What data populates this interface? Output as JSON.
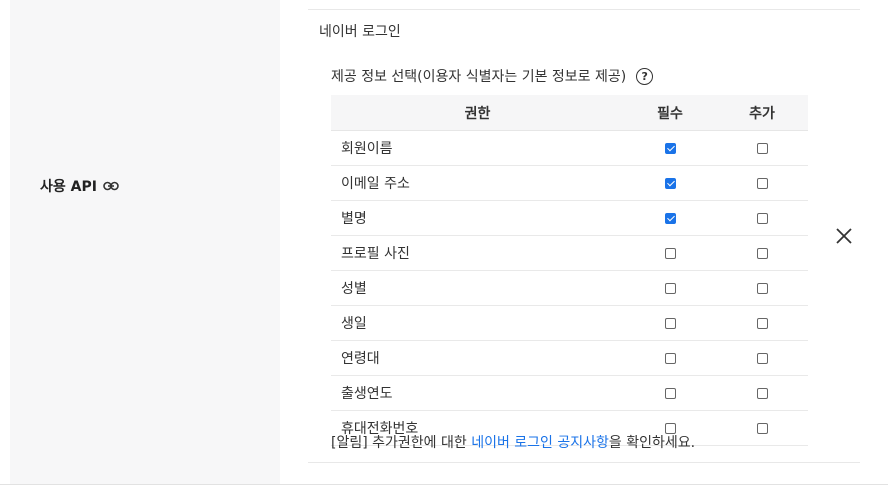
{
  "row_label": "사용 API",
  "service_title": "네이버 로그인",
  "info_text": "제공 정보 선택(이용자 식별자는 기본 정보로 제공)",
  "help_icon_char": "?",
  "table": {
    "headers": {
      "name": "권한",
      "required": "필수",
      "additional": "추가"
    },
    "rows": [
      {
        "name": "회원이름",
        "required": true,
        "additional": false
      },
      {
        "name": "이메일 주소",
        "required": true,
        "additional": false
      },
      {
        "name": "별명",
        "required": true,
        "additional": false
      },
      {
        "name": "프로필 사진",
        "required": false,
        "additional": false
      },
      {
        "name": "성별",
        "required": false,
        "additional": false
      },
      {
        "name": "생일",
        "required": false,
        "additional": false
      },
      {
        "name": "연령대",
        "required": false,
        "additional": false
      },
      {
        "name": "출생연도",
        "required": false,
        "additional": false
      },
      {
        "name": "휴대전화번호",
        "required": false,
        "additional": false
      }
    ]
  },
  "notice": {
    "prefix": "[알림] 추가권한에 대한 ",
    "link": "네이버 로그인 공지사항",
    "suffix": "을 확인하세요."
  },
  "colors": {
    "accent": "#1a73e8",
    "panel_bg": "#f7f7f8"
  }
}
